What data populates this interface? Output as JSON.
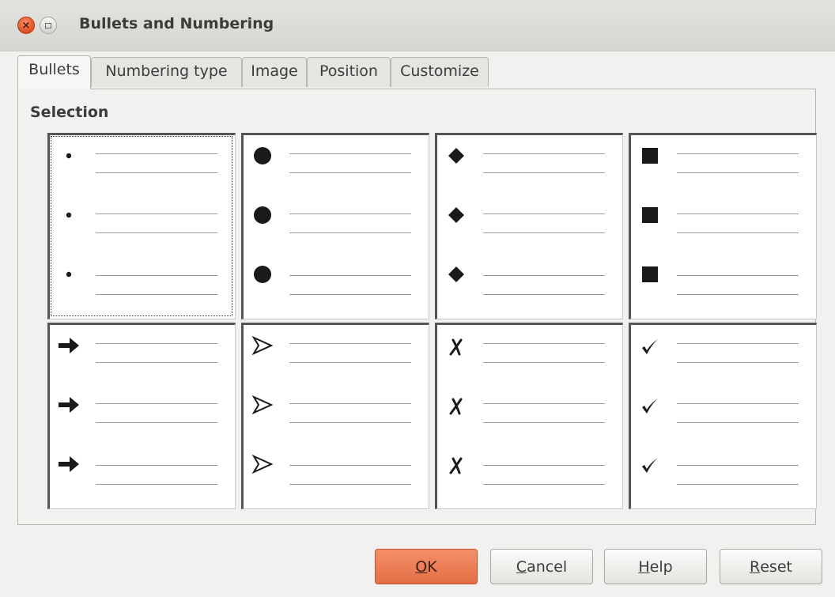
{
  "window": {
    "title": "Bullets and Numbering",
    "close_symbol": "×"
  },
  "tabs": [
    {
      "label": "Bullets",
      "active": true
    },
    {
      "label": "Numbering type",
      "active": false
    },
    {
      "label": "Image",
      "active": false
    },
    {
      "label": "Position",
      "active": false
    },
    {
      "label": "Customize",
      "active": false
    }
  ],
  "panel": {
    "section_label": "Selection",
    "bullet_styles": [
      {
        "icon": "small-dot-bullet-icon",
        "selected": true
      },
      {
        "icon": "large-circle-bullet-icon",
        "selected": false
      },
      {
        "icon": "diamond-bullet-icon",
        "selected": false
      },
      {
        "icon": "square-bullet-icon",
        "selected": false
      },
      {
        "icon": "bold-arrow-bullet-icon",
        "selected": false
      },
      {
        "icon": "arrowhead-bullet-icon",
        "selected": false
      },
      {
        "icon": "cross-mark-bullet-icon",
        "selected": false
      },
      {
        "icon": "check-mark-bullet-icon",
        "selected": false
      }
    ]
  },
  "buttons": {
    "ok": {
      "mnemonic": "O",
      "rest": "K"
    },
    "cancel": {
      "mnemonic": "C",
      "rest": "ancel"
    },
    "help": {
      "mnemonic": "H",
      "rest": "elp"
    },
    "reset": {
      "mnemonic": "R",
      "rest": "eset"
    }
  },
  "colors": {
    "primary_button": "#e36e45",
    "close_button": "#e2562a"
  }
}
